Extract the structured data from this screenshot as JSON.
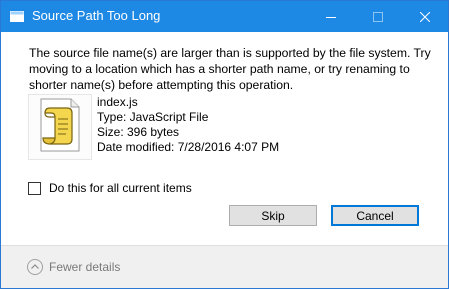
{
  "window": {
    "title": "Source Path Too Long",
    "titlebar_color": "#1e88e5",
    "icons": {
      "app": "explorer-window-icon",
      "minimize": "minimize-icon",
      "maximize": "maximize-icon",
      "close": "close-icon"
    }
  },
  "message": "The source file name(s) are larger than is supported by the file system. Try moving to a location which has a shorter path name, or try renaming to shorter name(s) before attempting this operation.",
  "file": {
    "icon": "javascript-file-icon",
    "name": "index.js",
    "type": "Type: JavaScript File",
    "size": "Size: 396 bytes",
    "date_modified": "Date modified: 7/28/2016 4:07 PM"
  },
  "checkbox": {
    "label": "Do this for all current items",
    "checked": false
  },
  "buttons": {
    "skip": "Skip",
    "cancel": "Cancel"
  },
  "footer": {
    "details_label": "Fewer details",
    "icon": "chevron-up-circle-icon"
  },
  "colors": {
    "accent": "#0078d7",
    "footer_bg": "#f0f0f0",
    "muted_text": "#7a7a7a"
  }
}
